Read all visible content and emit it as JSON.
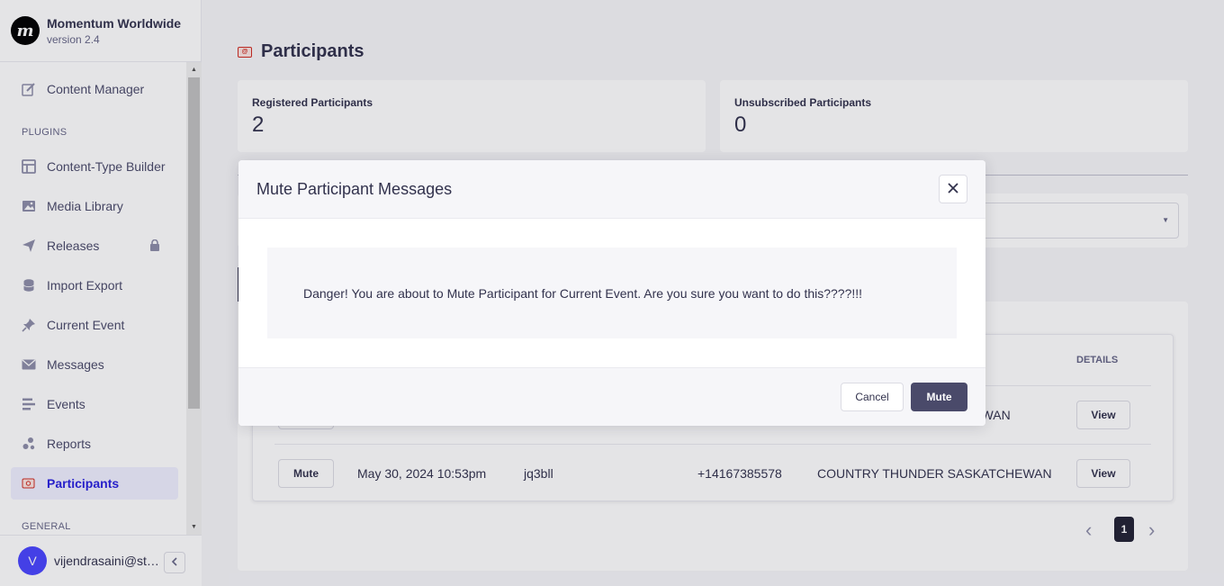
{
  "brand": {
    "name": "Momentum Worldwide",
    "version": "version 2.4",
    "logo_letter": "m"
  },
  "sidebar": {
    "items": [
      {
        "label": "Content Manager",
        "icon": "pencil-icon"
      },
      {
        "label": "Content-Type Builder",
        "icon": "layout-icon"
      },
      {
        "label": "Media Library",
        "icon": "image-icon"
      },
      {
        "label": "Releases",
        "icon": "paper-plane-icon",
        "locked": true
      },
      {
        "label": "Import Export",
        "icon": "database-icon"
      },
      {
        "label": "Current Event",
        "icon": "pin-icon"
      },
      {
        "label": "Messages",
        "icon": "envelope-icon"
      },
      {
        "label": "Events",
        "icon": "list-icon"
      },
      {
        "label": "Reports",
        "icon": "bubbles-icon"
      },
      {
        "label": "Participants",
        "icon": "participants-icon",
        "active": true
      }
    ],
    "sections": {
      "plugins": "PLUGINS",
      "general": "GENERAL"
    }
  },
  "user": {
    "initial": "V",
    "email": "vijendrasaini@sta..."
  },
  "page": {
    "title": "Participants"
  },
  "stats": [
    {
      "label": "Registered Participants",
      "value": "2"
    },
    {
      "label": "Unsubscribed Participants",
      "value": "0"
    }
  ],
  "table": {
    "header_details": "DETAILS",
    "rows": [
      {
        "action": "Mute",
        "event_partial": "CHEWAN",
        "details": "View"
      },
      {
        "action": "Mute",
        "date": "May 30, 2024 10:53pm",
        "code": "jq3bll",
        "phone": "+14167385578",
        "event": "COUNTRY THUNDER SASKATCHEWAN",
        "details": "View"
      }
    ]
  },
  "pagination": {
    "current": "1"
  },
  "modal": {
    "title": "Mute Participant Messages",
    "message": "Danger! You are about to Mute Participant for Current Event. Are you sure you want to do this????!!!",
    "cancel_label": "Cancel",
    "confirm_label": "Mute"
  },
  "colors": {
    "accent": "#4945ff",
    "active_bg": "#f0f0ff",
    "dark_button": "#4a4a6a"
  }
}
